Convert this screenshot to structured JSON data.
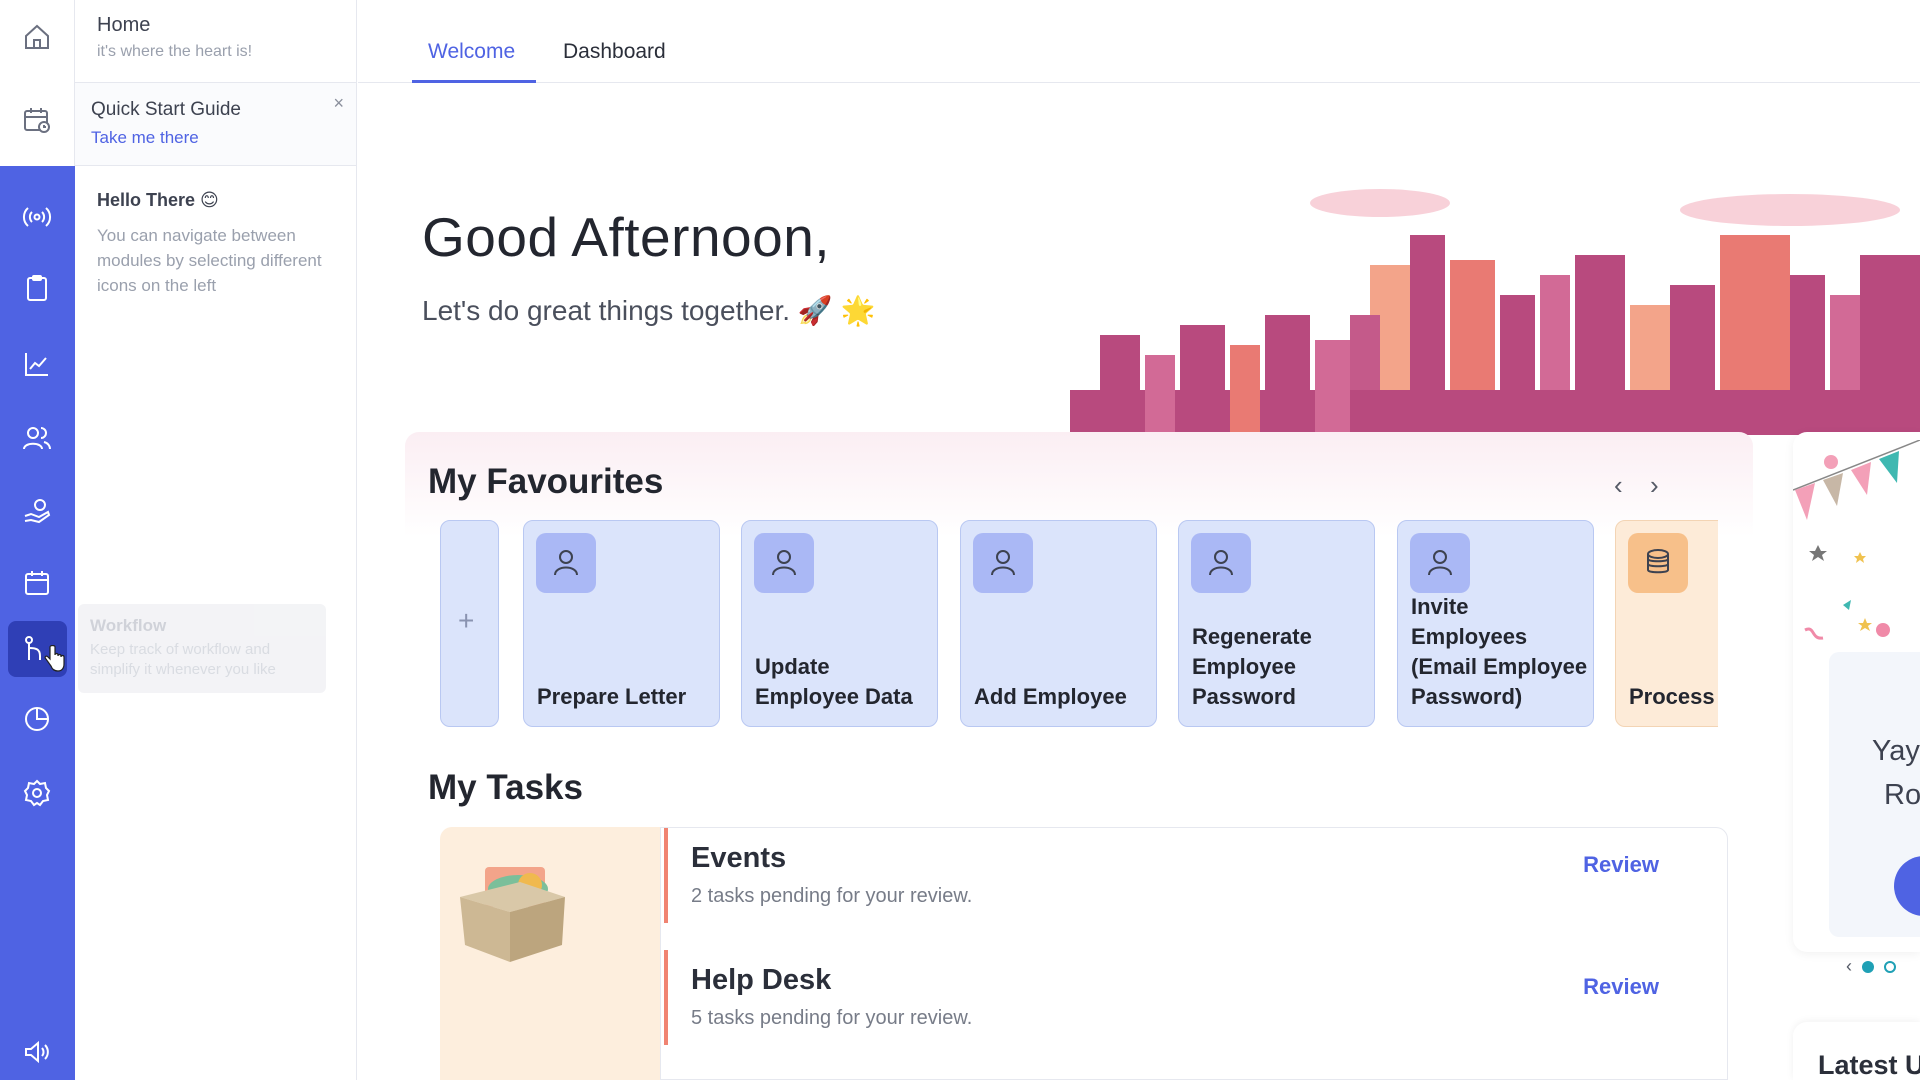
{
  "nav": {
    "home_title": "Home",
    "home_subtitle": "it's where the heart is!",
    "quick_start_title": "Quick Start Guide",
    "quick_start_link": "Take me there",
    "quick_start_close": "×",
    "hello_title": "Hello There 😊",
    "hello_text": "You can navigate between modules by selecting different icons on the left",
    "tooltip_title": "Workflow",
    "tooltip_text": "Keep track of workflow and simplify it whenever you like",
    "accent_color": "#4f63e3",
    "icons": [
      "home-icon",
      "calendar-clock-icon",
      "broadcast-icon",
      "clipboard-icon",
      "analytics-chart-icon",
      "people-icon",
      "hand-giving-icon",
      "calendar-icon",
      "workflow-icon",
      "pie-chart-icon",
      "settings-icon",
      "speaker-icon"
    ]
  },
  "tabs": {
    "welcome": "Welcome",
    "dashboard": "Dashboard",
    "active": "Welcome"
  },
  "hero": {
    "greeting": "Good Afternoon,",
    "tagline": "Let's do great things together. 🚀 🌟"
  },
  "favourites": {
    "title": "My Favourites",
    "prev": "‹",
    "next": "›",
    "add": "+",
    "cards": [
      {
        "label": "Prepare Letter",
        "icon": "user-icon",
        "color": "#dbe4fb"
      },
      {
        "label": "Update Employee Data",
        "icon": "user-icon",
        "color": "#dbe4fb"
      },
      {
        "label": "Add Employee",
        "icon": "user-icon",
        "color": "#dbe4fb"
      },
      {
        "label": "Regenerate Employee Password",
        "icon": "user-icon",
        "color": "#dbe4fb"
      },
      {
        "label": "Invite Employees (Email Employee Password)",
        "icon": "user-icon",
        "color": "#dbe4fb"
      },
      {
        "label": "Process F",
        "icon": "database-icon",
        "color": "#fdebd8"
      }
    ]
  },
  "tasks": {
    "title": "My Tasks",
    "items": [
      {
        "name": "Events",
        "desc": "2 tasks pending for your review.",
        "action": "Review"
      },
      {
        "name": "Help Desk",
        "desc": "5 tasks pending for your review.",
        "action": "Review"
      }
    ]
  },
  "promo": {
    "line1": "Yay",
    "line2": "Ro",
    "prev": "‹",
    "latest": "Latest U"
  }
}
